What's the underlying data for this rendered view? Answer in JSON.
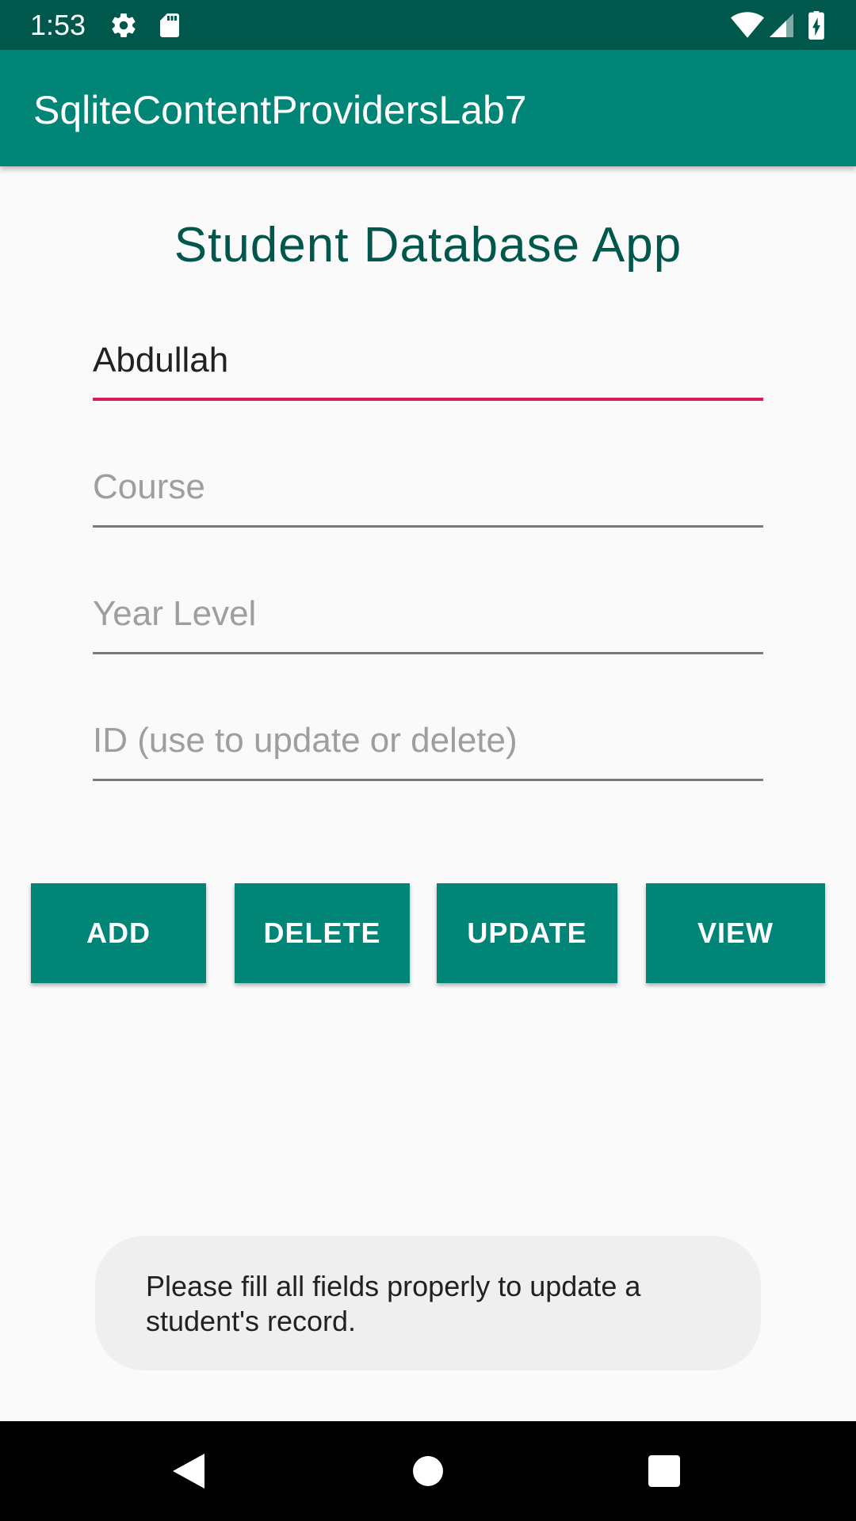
{
  "status_bar": {
    "time": "1:53",
    "left_icons": [
      "gear-icon",
      "sd-card-icon"
    ],
    "right_icons": [
      "wifi-icon",
      "cell-signal-icon",
      "battery-charging-icon"
    ],
    "background": "#00574b"
  },
  "app_bar": {
    "title": "SqliteContentProvidersLab7",
    "background": "#008577"
  },
  "main": {
    "heading": "Student Database App",
    "fields": {
      "name": {
        "value": "Abdullah",
        "placeholder": ""
      },
      "course": {
        "value": "",
        "placeholder": "Course"
      },
      "year_level": {
        "value": "",
        "placeholder": "Year Level"
      },
      "id": {
        "value": "",
        "placeholder": "ID (use to update or delete)"
      }
    },
    "buttons": {
      "add": "ADD",
      "delete": "DELETE",
      "update": "UPDATE",
      "view": "VIEW"
    }
  },
  "toast": {
    "message": "Please fill all fields properly to update a student's record."
  },
  "nav_bar": {
    "buttons": [
      "back-icon",
      "home-icon",
      "recents-icon"
    ]
  },
  "colors": {
    "primary": "#008577",
    "primary_dark": "#00574b",
    "accent": "#d81b60"
  }
}
